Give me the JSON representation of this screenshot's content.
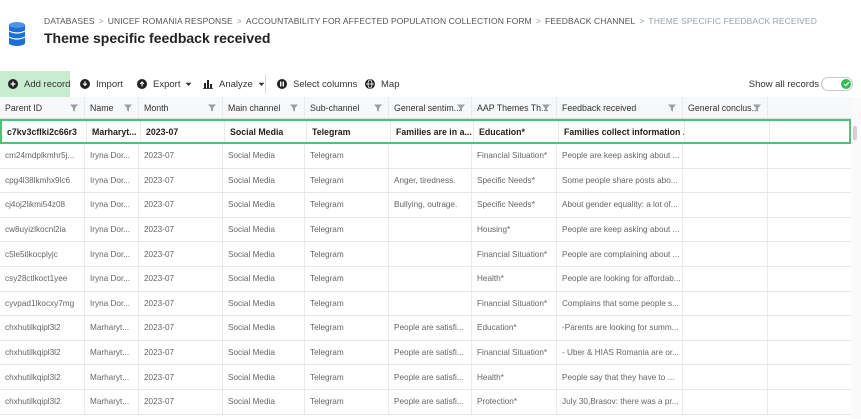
{
  "breadcrumb": {
    "items": [
      "DATABASES",
      "UNICEF ROMANIA RESPONSE",
      "ACCOUNTABILITY FOR AFFECTED POPULATION COLLECTION FORM",
      "FEEDBACK CHANNEL"
    ],
    "current": "THEME SPECIFIC FEEDBACK RECEIVED",
    "separator": ">"
  },
  "page": {
    "title": "Theme specific feedback received",
    "icon": "database-icon"
  },
  "toolbar": {
    "add_record": "Add record",
    "import": "Import",
    "export": "Export",
    "analyze": "Analyze",
    "select_columns": "Select columns",
    "map": "Map",
    "show_all_records": "Show all records"
  },
  "colors": {
    "accent": "#2ebf4f",
    "add_bg": "#c8ecd0",
    "selected_border": "#4fc27a"
  },
  "table": {
    "columns": [
      "Parent ID",
      "Name",
      "Month",
      "Main channel",
      "Sub-channel",
      "General sentim...",
      "AAP Themes Th...",
      "Feedback received",
      "General conclus..."
    ],
    "rows": [
      [
        "c7kv3cflki2c66r3",
        "Marharyt...",
        "2023-07",
        "Social Media",
        "Telegram",
        "Families are in a...",
        "Education*",
        "Families collect information ...",
        ""
      ],
      [
        "cm24mdplkmhr5j...",
        "Iryna Dor...",
        "2023-07",
        "Social Media",
        "Telegram",
        "",
        "Financial Situation*",
        "People are keep asking about ...",
        ""
      ],
      [
        "cpg4l38lkmhx9lc6",
        "Iryna Dor...",
        "2023-07",
        "Social Media",
        "Telegram",
        "Anger, tiredness.",
        "Specific Needs*",
        "Some people share posts abo...",
        ""
      ],
      [
        "cj4oj2likmi54z08",
        "Iryna Dor...",
        "2023-07",
        "Social Media",
        "Telegram",
        "Bullying, outrage.",
        "Specific Needs*",
        "About gender equality: a lot of...",
        ""
      ],
      [
        "cw8uyizlkocnl2ia",
        "Iryna Dor...",
        "2023-07",
        "Social Media",
        "Telegram",
        "",
        "Housing*",
        "People are keep asking about ...",
        ""
      ],
      [
        "c5le5tlkocplyjc",
        "Iryna Dor...",
        "2023-07",
        "Social Media",
        "Telegram",
        "",
        "Financial Situation*",
        "People are complaining about ...",
        ""
      ],
      [
        "csy28ctlkoct1yee",
        "Iryna Dor...",
        "2023-07",
        "Social Media",
        "Telegram",
        "",
        "Health*",
        "People are looking for affordab...",
        ""
      ],
      [
        "cyvpad1lkocxy7mg",
        "Iryna Dor...",
        "2023-07",
        "Social Media",
        "Telegram",
        "",
        "Financial Situation*",
        "Complains that some people s...",
        ""
      ],
      [
        "chxhutilkqipl3l2",
        "Marharyt...",
        "2023-07",
        "Social Media",
        "Telegram",
        "People are satisfi...",
        "Education*",
        "-Parents are looking for summ...",
        ""
      ],
      [
        "chxhutilkqipl3l2",
        "Marharyt...",
        "2023-07",
        "Social Media",
        "Telegram",
        "People are satisfi...",
        "Financial Situation*",
        "- Uber & HIAS Romania are or...",
        ""
      ],
      [
        "chxhutilkqipl3l2",
        "Marharyt...",
        "2023-07",
        "Social Media",
        "Telegram",
        "People are satisfi...",
        "Health*",
        "People say that they have to ...",
        ""
      ],
      [
        "chxhutilkqipl3l2",
        "Marharyt...",
        "2023-07",
        "Social Media",
        "Telegram",
        "People are satisfi...",
        "Protection*",
        "July 30,Brasov: there was a pr...",
        ""
      ]
    ]
  }
}
